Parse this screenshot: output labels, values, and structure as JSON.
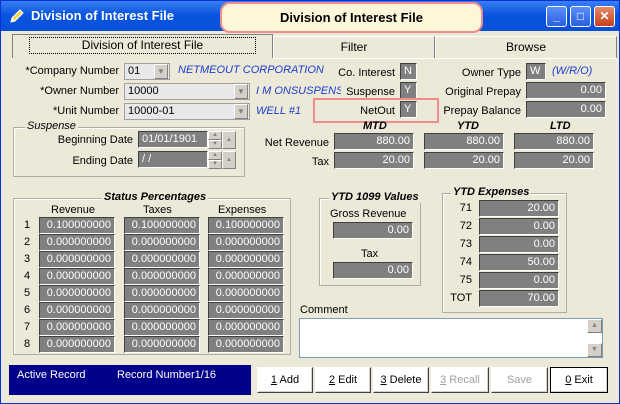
{
  "window": {
    "title": "Division of Interest File"
  },
  "callout": {
    "text": "Division of Interest File"
  },
  "tabs": {
    "main": "Division of Interest File",
    "filter": "Filter",
    "browse": "Browse"
  },
  "company": {
    "label": "*Company Number",
    "value": "01",
    "name": "NETMEOUT CORPORATION"
  },
  "owner": {
    "label": "*Owner Number",
    "value": "10000",
    "name": "I M ONSUSPENS"
  },
  "unit": {
    "label": "*Unit Number",
    "value": "10000-01",
    "name": "WELL #1"
  },
  "co_interest": {
    "label": "Co. Interest",
    "value": "N"
  },
  "suspense_flag": {
    "label": "Suspense",
    "value": "Y"
  },
  "netout": {
    "label": "NetOut",
    "value": "Y"
  },
  "owner_type": {
    "label": "Owner Type",
    "value": "W",
    "hint": "(W/R/O)"
  },
  "original_prepay": {
    "label": "Original Prepay",
    "value": "0.00"
  },
  "prepay_balance": {
    "label": "Prepay Balance",
    "value": "0.00"
  },
  "suspense": {
    "title": "Suspense",
    "begin_label": "Beginning Date",
    "begin_value": "01/01/1901",
    "end_label": "Ending Date",
    "end_value": " / /"
  },
  "totals": {
    "headers": [
      "MTD",
      "YTD",
      "LTD"
    ],
    "net_revenue_label": "Net Revenue",
    "tax_label": "Tax",
    "net_revenue": [
      "880.00",
      "880.00",
      "880.00"
    ],
    "tax": [
      "20.00",
      "20.00",
      "20.00"
    ]
  },
  "status_pct": {
    "title": "Status Percentages",
    "headers": [
      "Revenue",
      "Taxes",
      "Expenses"
    ],
    "rows": [
      {
        "n": "1",
        "v": [
          "0.100000000",
          "0.100000000",
          "0.100000000"
        ]
      },
      {
        "n": "2",
        "v": [
          "0.000000000",
          "0.000000000",
          "0.000000000"
        ]
      },
      {
        "n": "3",
        "v": [
          "0.000000000",
          "0.000000000",
          "0.000000000"
        ]
      },
      {
        "n": "4",
        "v": [
          "0.000000000",
          "0.000000000",
          "0.000000000"
        ]
      },
      {
        "n": "5",
        "v": [
          "0.000000000",
          "0.000000000",
          "0.000000000"
        ]
      },
      {
        "n": "6",
        "v": [
          "0.000000000",
          "0.000000000",
          "0.000000000"
        ]
      },
      {
        "n": "7",
        "v": [
          "0.000000000",
          "0.000000000",
          "0.000000000"
        ]
      },
      {
        "n": "8",
        "v": [
          "0.000000000",
          "0.000000000",
          "0.000000000"
        ]
      }
    ]
  },
  "ytd1099": {
    "title": "YTD 1099 Values",
    "gross_label": "Gross Revenue",
    "gross_value": "0.00",
    "tax_label": "Tax",
    "tax_value": "0.00"
  },
  "ytd_exp": {
    "title": "YTD Expenses",
    "rows": [
      {
        "n": "71",
        "v": "20.00"
      },
      {
        "n": "72",
        "v": "0.00"
      },
      {
        "n": "73",
        "v": "0.00"
      },
      {
        "n": "74",
        "v": "50.00"
      },
      {
        "n": "75",
        "v": "0.00"
      },
      {
        "n": "TOT",
        "v": "70.00"
      }
    ]
  },
  "comment": {
    "label": "Comment",
    "value": ""
  },
  "status": {
    "active": "Active Record",
    "record": "Record Number1/16"
  },
  "buttons": {
    "add": {
      "key": "1",
      "rest": " Add"
    },
    "edit": {
      "key": "2",
      "rest": " Edit"
    },
    "delete": {
      "key": "3",
      "rest": " Delete"
    },
    "recall": {
      "key": "3",
      "rest": " Recall"
    },
    "save": {
      "label": "Save"
    },
    "exit": {
      "key": "0",
      "rest": " Exit"
    }
  },
  "colors": {
    "titlebar": "#0a54e0",
    "status_bg": "#00008b",
    "highlight": "#f08c8c",
    "link_text": "#1a3cd0"
  }
}
